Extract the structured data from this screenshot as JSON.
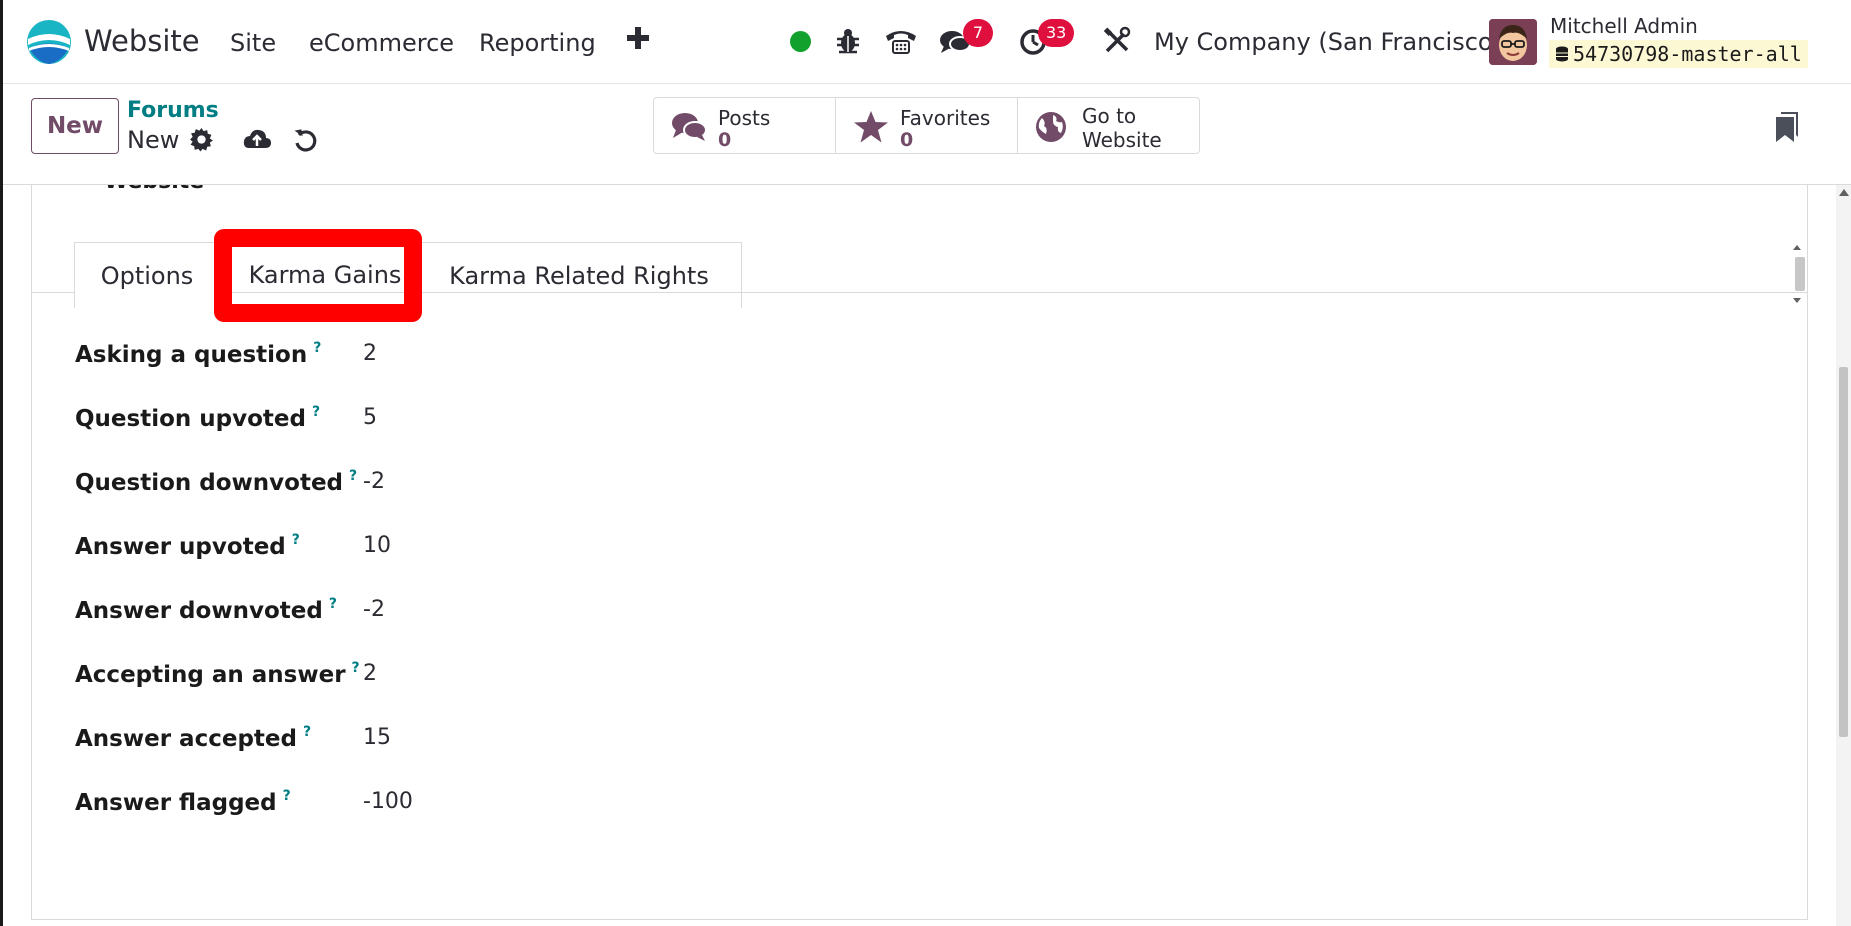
{
  "navbar": {
    "app_name": "Website",
    "menu": [
      "Site",
      "eCommerce",
      "Reporting"
    ],
    "badges": {
      "messages": "7",
      "activities": "33"
    },
    "company": "My Company (San Francisco)",
    "user_name": "Mitchell Admin",
    "database": "54730798-master-all"
  },
  "control_panel": {
    "new_label": "New",
    "breadcrumb": "Forums",
    "record_name": "New",
    "stats": [
      {
        "label": "Posts",
        "value": "0"
      },
      {
        "label": "Favorites",
        "value": "0"
      },
      {
        "label": "Go to",
        "label2": "Website"
      }
    ]
  },
  "form": {
    "cut_label": "Website",
    "tabs": [
      "Options",
      "Karma Gains",
      "Karma Related Rights"
    ],
    "active_tab": "Karma Gains",
    "fields": [
      {
        "label": "Asking a question",
        "value": "2"
      },
      {
        "label": "Question upvoted",
        "value": "5"
      },
      {
        "label": "Question downvoted",
        "value": "-2"
      },
      {
        "label": "Answer upvoted",
        "value": "10"
      },
      {
        "label": "Answer downvoted",
        "value": "-2"
      },
      {
        "label": "Accepting an answer",
        "value": "2"
      },
      {
        "label": "Answer accepted",
        "value": "15"
      },
      {
        "label": "Answer flagged",
        "value": "-100"
      }
    ],
    "help_mark": "?"
  },
  "colors": {
    "brand": "#714b67",
    "link": "#017e84",
    "badge": "#e0103e",
    "highlight": "#ff0000",
    "online": "#12a12c"
  },
  "icons": [
    "website-logo-icon",
    "plus-icon",
    "bug-icon",
    "phone-icon",
    "chat-icon",
    "clock-icon",
    "tools-icon",
    "gear-icon",
    "cloud-upload-icon",
    "undo-icon",
    "comments-icon",
    "star-icon",
    "globe-icon",
    "bookmark-icon",
    "database-icon"
  ]
}
